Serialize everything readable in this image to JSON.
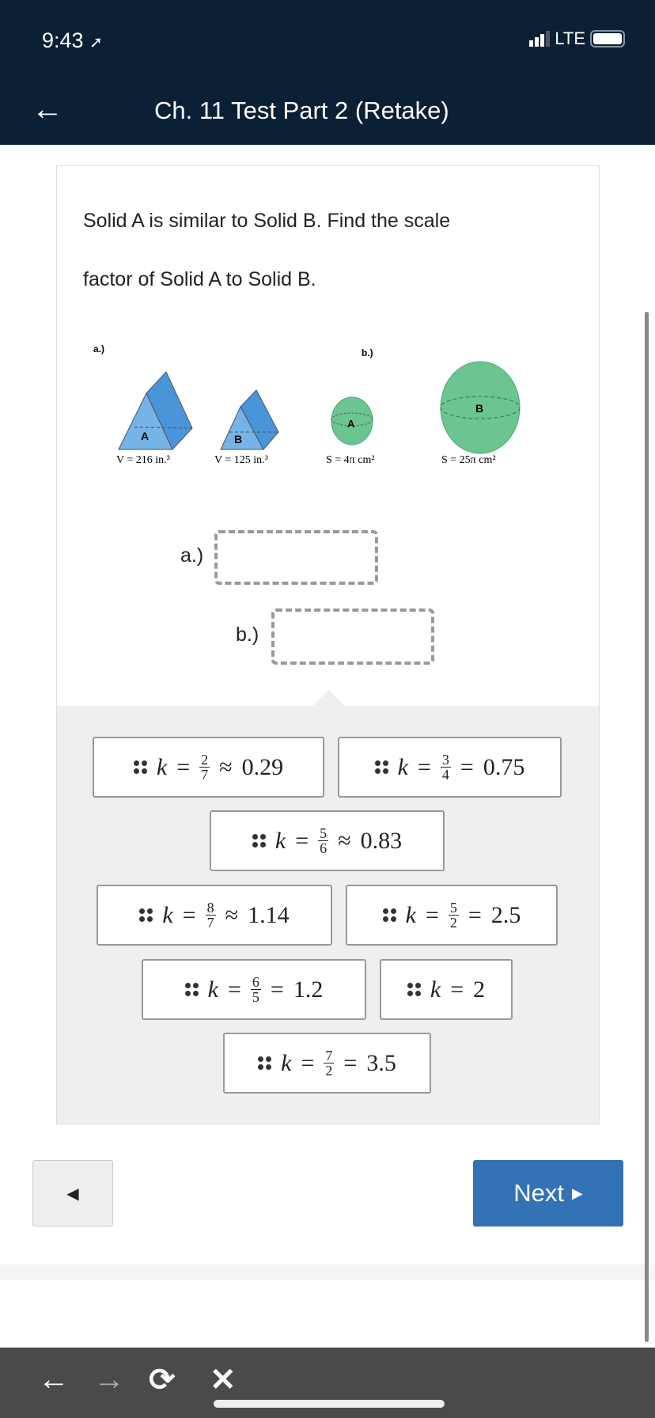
{
  "status_bar": {
    "time": "9:43",
    "network": "LTE",
    "battery_percent": 100
  },
  "header": {
    "title": "Ch. 11 Test Part 2 (Retake)",
    "back_icon": "arrow-left-icon"
  },
  "question": {
    "line1": "Solid A is similar to Solid B.  Find the scale",
    "line2": "factor of Solid A to Solid B."
  },
  "figure": {
    "part_a_label": "a.)",
    "part_b_label": "b.)",
    "prism_a": {
      "label": "A",
      "caption": "V = 216 in.³"
    },
    "prism_b": {
      "label": "B",
      "caption": "V = 125 in.³"
    },
    "sphere_a": {
      "label": "A",
      "caption": "S = 4π cm²"
    },
    "sphere_b": {
      "label": "B",
      "caption": "S = 25π cm²"
    }
  },
  "answers": [
    {
      "label": "a.)"
    },
    {
      "label": "b.)"
    }
  ],
  "choices": [
    {
      "k": "k",
      "rel1": "=",
      "num": "2",
      "den": "7",
      "rel2": "≈",
      "value": "0.29"
    },
    {
      "k": "k",
      "rel1": "=",
      "num": "3",
      "den": "4",
      "rel2": "=",
      "value": "0.75"
    },
    {
      "k": "k",
      "rel1": "=",
      "num": "5",
      "den": "6",
      "rel2": "≈",
      "value": "0.83"
    },
    {
      "k": "k",
      "rel1": "=",
      "num": "8",
      "den": "7",
      "rel2": "≈",
      "value": "1.14"
    },
    {
      "k": "k",
      "rel1": "=",
      "num": "5",
      "den": "2",
      "rel2": "=",
      "value": "2.5"
    },
    {
      "k": "k",
      "rel1": "=",
      "num": "6",
      "den": "5",
      "rel2": "=",
      "value": "1.2"
    },
    {
      "k": "k",
      "rel1": "=",
      "value": "2"
    },
    {
      "k": "k",
      "rel1": "=",
      "num": "7",
      "den": "2",
      "rel2": "=",
      "value": "3.5"
    }
  ],
  "buttons": {
    "prev": "◀",
    "next": "Next",
    "next_arrow": "▶"
  },
  "colors": {
    "header_bg": "#0b2035",
    "next_bg": "#3372b4",
    "prism": "#5fa8e0",
    "sphere": "#6cc590"
  },
  "browser_toolbar": {
    "back": "←",
    "forward": "→",
    "reload": "⟳",
    "close": "✕"
  }
}
